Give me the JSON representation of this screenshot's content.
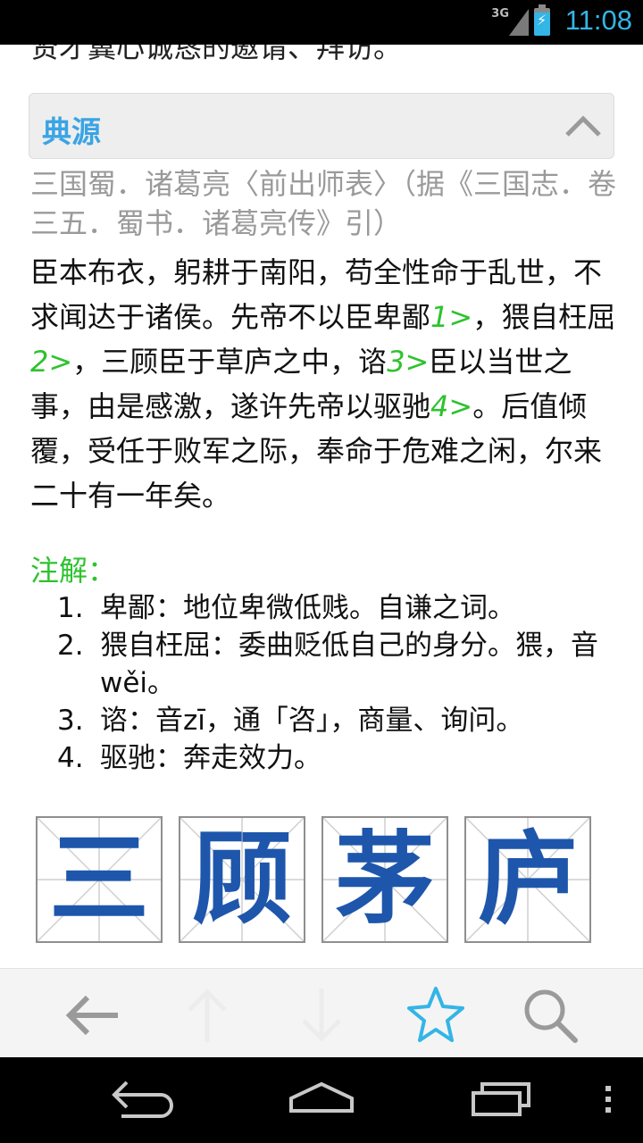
{
  "status_bar": {
    "network": "3G",
    "time": "11:08"
  },
  "content": {
    "cut_off_line": "贤才冀心诚恳的邀请、拜访。",
    "source_header": {
      "title": "典源"
    },
    "citation": "三国蜀．诸葛亮〈前出师表〉（据《三国志．卷三五．蜀书．诸葛亮传》引）",
    "quote": {
      "p1": "臣本布衣，躬耕于南阳，苟全性命于乱世，不求闻达于诸侯。先帝不以臣卑鄙",
      "r1": "1>",
      "p2": "，猥自枉屈",
      "r2": "2>",
      "p3": "，三顾臣于草庐之中，谘",
      "r3": "3>",
      "p4": "臣以当世之事，由是感激，遂许先帝以驱驰",
      "r4": "4>",
      "p5": "。后值倾覆，受任于败军之际，奉命于危难之闲，尔来二十有一年矣。"
    },
    "notes_title": "注解：",
    "notes": [
      {
        "num": "1.",
        "text": "卑鄙：地位卑微低贱。自谦之词。"
      },
      {
        "num": "2.",
        "text": "猥自枉屈：委曲贬低自己的身分。猥，音wěi。"
      },
      {
        "num": "3.",
        "text": "谘：音zī，通「咨」，商量、询问。"
      },
      {
        "num": "4.",
        "text": "驱驰：奔走效力。"
      }
    ],
    "characters": [
      "三",
      "顾",
      "茅",
      "庐"
    ]
  },
  "toolbar": {
    "icons": [
      "back-arrow-icon",
      "up-arrow-icon",
      "down-arrow-icon",
      "star-icon",
      "search-icon"
    ],
    "accent": "#33b5e5"
  },
  "nav_bar": {
    "icons": [
      "back-icon",
      "home-icon",
      "recents-icon",
      "menu-icon"
    ]
  }
}
